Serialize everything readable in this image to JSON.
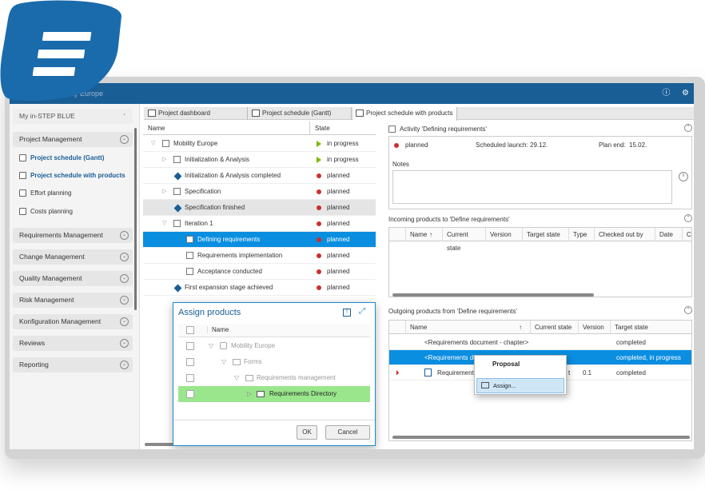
{
  "app": {
    "title": "Mobility Europe",
    "user_menu": "My in-STEP BLUE"
  },
  "colors": {
    "accent": "#1a5e96",
    "selection": "#0a8ee0",
    "planned": "#c9302c",
    "in_progress": "#7ab800",
    "highlight": "#9ae68c"
  },
  "sidebar": {
    "project_management": "Project Management",
    "items": [
      "Project schedule (Gantt)",
      "Project schedule with products",
      "Effort planning",
      "Costs planning"
    ],
    "groups": [
      "Requirements Management",
      "Change Management",
      "Quality  Management",
      "Risk Management",
      "Konfiguration Management",
      "Reviews",
      "Reporting"
    ]
  },
  "tabs": [
    "Project dashboard",
    "Project schedule (Gantt)",
    "Project schedule with products"
  ],
  "tree": {
    "headers": [
      "Name",
      "State"
    ],
    "rows": [
      {
        "name": "Mobility Europe",
        "state": "in progress"
      },
      {
        "name": "Initialization & Analysis",
        "state": "in progress"
      },
      {
        "name": "Initialization & Analysis completed",
        "state": "planned"
      },
      {
        "name": "Specification",
        "state": "planned"
      },
      {
        "name": "Specification finished",
        "state": "planned"
      },
      {
        "name": "Iteration 1",
        "state": "planned"
      },
      {
        "name": "Defining requirements",
        "state": "planned"
      },
      {
        "name": "Requirements implementation",
        "state": "planned"
      },
      {
        "name": "Acceptance conducted",
        "state": "planned"
      },
      {
        "name": "First expansion stage achieved",
        "state": "planned"
      }
    ]
  },
  "activity": {
    "title": "Activity 'Defining requirements'",
    "state": "planned",
    "scheduled_label": "Scheduled launch:",
    "scheduled_value": "29.12.",
    "plan_end_label": "Plan end:",
    "plan_end_value": "15.02.",
    "notes_label": "Notes"
  },
  "incoming": {
    "title": "Incoming products to 'Define requirements'",
    "columns": [
      "Name",
      "Current state",
      "Version",
      "Target state",
      "Type",
      "Checked out by",
      "Date",
      "Co"
    ]
  },
  "outgoing": {
    "title": "Outgoing products from 'Define requirements'",
    "columns": [
      "Name",
      "Current state",
      "Version",
      "Target state"
    ],
    "rows": [
      {
        "name": "<Requirements document - chapter>",
        "version": "",
        "target": "completed"
      },
      {
        "name": "<Requirements di",
        "version": "",
        "target": "completed, in progress"
      },
      {
        "name": "Requirements",
        "state_frag": "t",
        "version": "0.1",
        "target": "completed"
      }
    ]
  },
  "dialog": {
    "title": "Assign products",
    "header": "Name",
    "rows": [
      "Mobility Europe",
      "Forms",
      "Requirements management",
      "Requirements Directory"
    ],
    "ok": "OK",
    "cancel": "Cancel"
  },
  "context_menu": {
    "items": [
      "Proposal",
      "Assign..."
    ]
  }
}
